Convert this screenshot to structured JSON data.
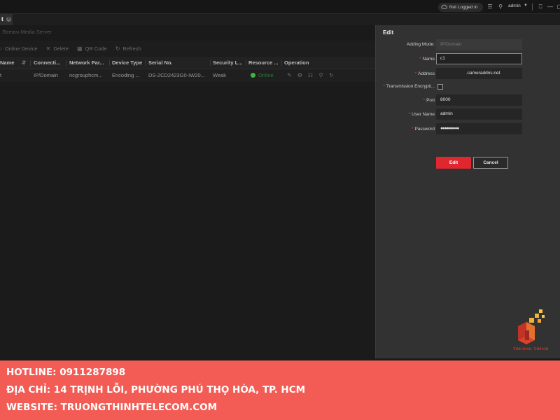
{
  "titlebar": {
    "cloud_status": "Not Logged in",
    "user": "admin"
  },
  "tab": {
    "label": "t"
  },
  "subheader": {
    "label": "Stream Media Server"
  },
  "toolbar": {
    "online_device": "Online Device",
    "delete": "Delete",
    "qr_code": "QR Code",
    "refresh": "Refresh"
  },
  "table": {
    "columns": [
      "Name",
      "Connecti...",
      "Network Par...",
      "Device Type",
      "Serial No.",
      "Security L...",
      "Resource ...",
      "Operation"
    ],
    "rows": [
      {
        "name": "t",
        "connection": "IP/Domain",
        "network": "ncgrouphcm...",
        "device_type": "Encoding ...",
        "serial": "DS-2CD2423G0-IW20...",
        "security": "Weak",
        "resource": "Online"
      }
    ]
  },
  "edit_panel": {
    "title": "Edit",
    "adding_mode_label": "Adding Mode:",
    "adding_mode_value": "IP/Domain",
    "name_label": "Name",
    "name_value": "c1",
    "address_label": "Address",
    "address_value": ".cameraddns.net",
    "transmission_label": "Transmission Encrypti...",
    "port_label": "Port",
    "port_value": "8000",
    "username_label": "User Name",
    "username_value": "admin",
    "password_label": "Password",
    "password_value": "●●●●●●●●●",
    "edit_button": "Edit",
    "cancel_button": "Cancel"
  },
  "logo": {
    "text": "TRUONG THINH"
  },
  "banner": {
    "hotline": "HOTLINE: 0911287898",
    "address": "ĐỊA CHỈ: 14 TRỊNH LỖI, PHƯỜNG PHÚ THỌ HÒA, TP. HCM",
    "website": "WEBSITE: TRUONGTHINHTELECOM.COM"
  },
  "colors": {
    "accent_red": "#e0262e",
    "banner_bg": "#f25c54",
    "online_green": "#3db34a"
  }
}
